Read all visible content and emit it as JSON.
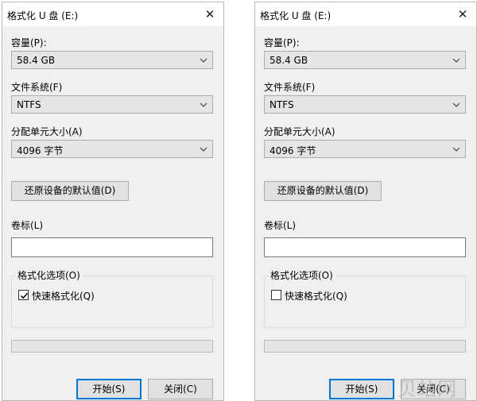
{
  "dialogs": [
    {
      "title": "格式化 U 盘 (E:)",
      "close_glyph": "✕",
      "capacity_label": "容量(P):",
      "capacity_value": "58.4 GB",
      "filesystem_label": "文件系统(F)",
      "filesystem_value": "NTFS",
      "allocation_label": "分配单元大小(A)",
      "allocation_value": "4096 字节",
      "restore_defaults_label": "还原设备的默认值(D)",
      "volume_label": "卷标(L)",
      "volume_value": "",
      "format_options_label": "格式化选项(O)",
      "quick_format_label": "快速格式化(Q)",
      "quick_format_checked": true,
      "progress": 0,
      "start_label": "开始(S)",
      "close_label": "关闭(C)"
    },
    {
      "title": "格式化 U 盘 (E:)",
      "close_glyph": "✕",
      "capacity_label": "容量(P):",
      "capacity_value": "58.4 GB",
      "filesystem_label": "文件系统(F)",
      "filesystem_value": "NTFS",
      "allocation_label": "分配单元大小(A)",
      "allocation_value": "4096 字节",
      "restore_defaults_label": "还原设备的默认值(D)",
      "volume_label": "卷标(L)",
      "volume_value": "",
      "format_options_label": "格式化选项(O)",
      "quick_format_label": "快速格式化(Q)",
      "quick_format_checked": false,
      "progress": 0,
      "start_label": "开始(S)",
      "close_label": "关闭(C)"
    }
  ],
  "watermark": "贝站网",
  "icons": {
    "close": "close-icon",
    "dropdown": "chevron-down-icon",
    "check": "checkmark-icon"
  },
  "colors": {
    "dialog_bg": "#f0f0f0",
    "titlebar_bg": "#ffffff",
    "default_button_border": "#0078d7"
  }
}
